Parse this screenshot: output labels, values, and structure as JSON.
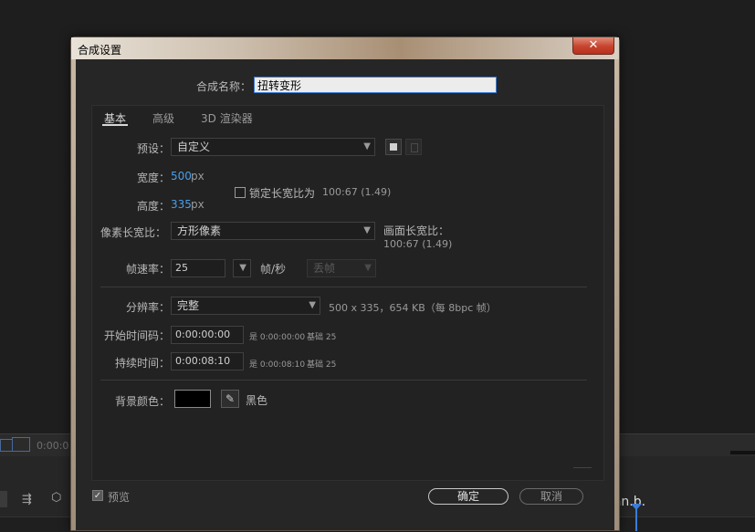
{
  "background": {
    "timecode": "0:00:0",
    "panel_text": "'an.b."
  },
  "dialog": {
    "title": "合成设置",
    "close_glyph": "✕",
    "name_label": "合成名称：",
    "name_value": "扭转变形",
    "tabs": [
      {
        "label": "基本",
        "active": true
      },
      {
        "label": "高级",
        "active": false
      },
      {
        "label": "3D 渲染器",
        "active": false
      }
    ],
    "preset": {
      "label": "预设：",
      "value": "自定义"
    },
    "width": {
      "label": "宽度：",
      "value": "500",
      "unit": "px"
    },
    "height": {
      "label": "高度：",
      "value": "335",
      "unit": "px"
    },
    "lock_aspect": {
      "label": "锁定长宽比为",
      "ratio": "100:67 (1.49)",
      "checked": false
    },
    "pixel_aspect": {
      "label": "像素长宽比：",
      "value": "方形像素"
    },
    "frame_aspect": {
      "label": "画面长宽比：",
      "value": "100:67 (1.49)"
    },
    "frame_rate": {
      "label": "帧速率：",
      "value": "25",
      "unit": "帧/秒",
      "drop_frame": "丢帧"
    },
    "resolution": {
      "label": "分辨率：",
      "value": "完整",
      "info": "500 x 335，654 KB（每 8bpc 帧）"
    },
    "start_timecode": {
      "label": "开始时间码：",
      "value": "0:00:00:00",
      "equals": "是 0:00:00:00",
      "base": "基础 25"
    },
    "duration": {
      "label": "持续时间：",
      "value": "0:00:08:10",
      "equals": "是 0:00:08:10",
      "base": "基础 25"
    },
    "bg_color": {
      "label": "背景颜色：",
      "name": "黑色",
      "hex": "#000000"
    },
    "preview": {
      "label": "预览",
      "checked": true
    },
    "ok_label": "确定",
    "cancel_label": "取消"
  }
}
